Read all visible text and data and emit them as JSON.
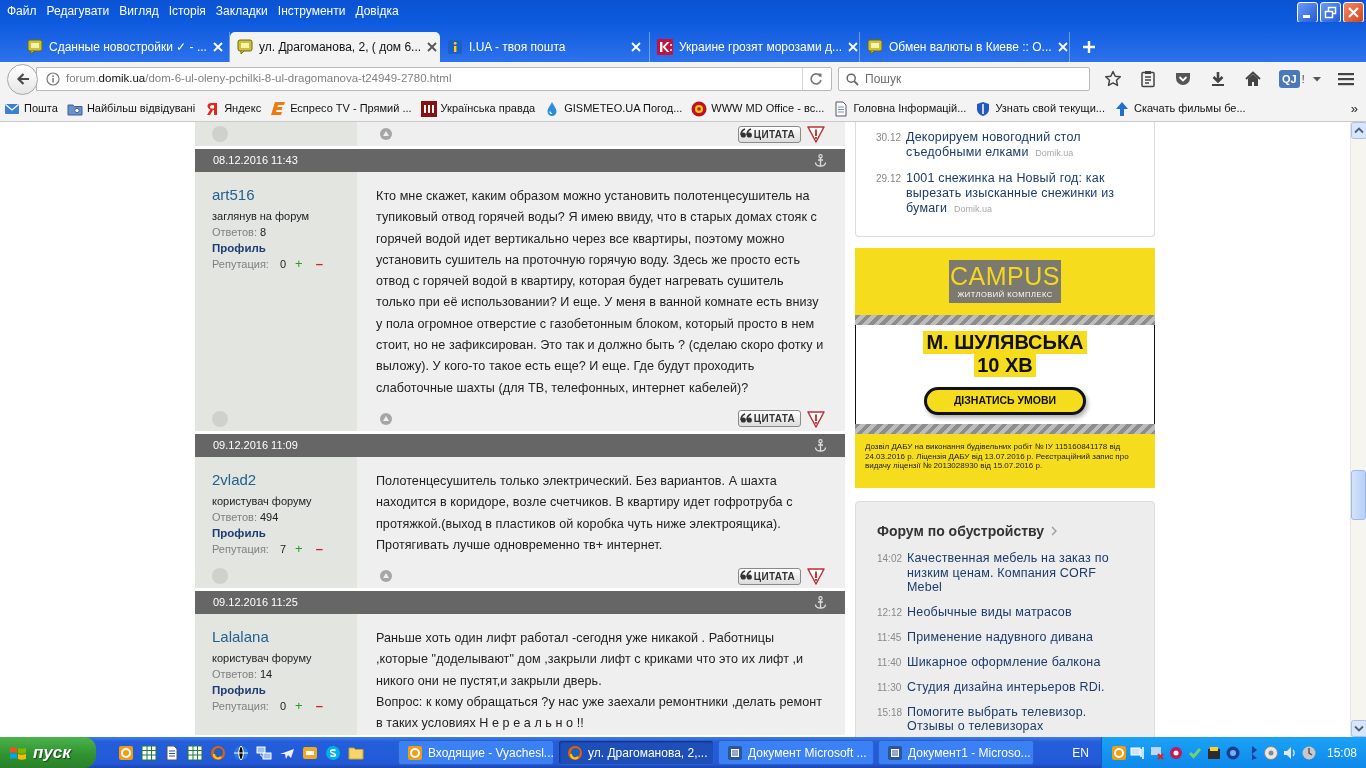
{
  "menu": [
    "Файл",
    "Редагувати",
    "Вигляд",
    "Історія",
    "Закладки",
    "Інструменти",
    "Довідка"
  ],
  "tabs": [
    {
      "title": "Сданные новостройки ✓ - ...",
      "selected": false
    },
    {
      "title": "ул. Драгоманова, 2, ( дом 6...",
      "selected": true
    },
    {
      "title": "I.UA - твоя пошта",
      "selected": false
    },
    {
      "title": "Украине грозят морозами д...",
      "selected": false
    },
    {
      "title": "Обмен валюты в Киеве :: О...",
      "selected": false
    }
  ],
  "address": {
    "url_prefix": "forum.",
    "url_domain": "domik.ua",
    "url_path": "/dom-6-ul-oleny-pchilki-8-ul-dragomanova-t24949-2780.html"
  },
  "search": {
    "placeholder": "Пошук"
  },
  "extension": {
    "label": "QJ",
    "badge": "!"
  },
  "bookmarks": [
    {
      "title": "Пошта"
    },
    {
      "title": "Найбільш відвідувані"
    },
    {
      "title": "Яндекс"
    },
    {
      "title": "Еспресо TV - Прямий ..."
    },
    {
      "title": "Українська правда"
    },
    {
      "title": "GISMETEO.UA Погод..."
    },
    {
      "title": "WWW MD Office - вс..."
    },
    {
      "title": "Головна Інформацій..."
    },
    {
      "title": "Узнать свой текущи..."
    },
    {
      "title": "Скачать фильмы бе..."
    }
  ],
  "bookmarks_more": "»",
  "prev_post_footer": {
    "quote_button": "ЦИТАТА"
  },
  "posts": [
    {
      "date": "08.12.2016 11:43",
      "author": "art516",
      "rank": "заглянув на форум",
      "replies_label": "Ответов:",
      "replies": "8",
      "profile": "Профиль",
      "reputation_label": "Репутация:",
      "reputation": "0",
      "rep_plus": "+",
      "rep_minus": "–",
      "message": [
        "Кто мне скажет, каким образом можно установить полотенцесушитель на тупиковый отвод горячей воды? Я имею ввиду, что в старых домах стояк с горячей водой идет вертикально через все квартиры, поэтому можно установить сушитель на проточную горячую воду. Здесь же просто есть отвод с горячей водой в квартиру, которая будет нагревать сушитель только при её использовании? И еще. У меня в ванной комнате есть внизу у пола огромное отверстие с газобетонным блоком, который просто в нем стоит, но не зафиксирован. Это так и должно быть ? (сделаю скоро фотку и выложу). У кого-то такое есть еще? И еще. Где будут проходить слаботочные шахты (для ТВ, телефонных, интернет кабелей)?"
      ],
      "quote_button": "ЦИТАТА"
    },
    {
      "date": "09.12.2016 11:09",
      "author": "2vlad2",
      "rank": "користувач форуму",
      "replies_label": "Ответов:",
      "replies": "494",
      "profile": "Профиль",
      "reputation_label": "Репутация:",
      "reputation": "7",
      "rep_plus": "+",
      "rep_minus": "–",
      "message": [
        "Полотенцесушитель только электрический. Без вариантов. А шахта находится в коридоре, возле счетчиков. В квартиру идет гофротруба с протяжкой.(выход в пластиков ой коробка чуть ниже электроящика). Протягивать лучше одновременно тв+ интернет."
      ],
      "quote_button": "ЦИТАТА"
    },
    {
      "date": "09.12.2016 11:25",
      "author": "Lalalana",
      "rank": "користувач форуму",
      "replies_label": "Ответов:",
      "replies": "14",
      "profile": "Профиль",
      "reputation_label": "Репутация:",
      "reputation": "0",
      "rep_plus": "+",
      "rep_minus": "–",
      "message": [
        "Раньше хоть один лифт работал -сегодня уже никакой . Работницы ,которые \"доделывают\" дом ,закрыли лифт с криками что это их лифт ,и никого они не пустят,и закрыли дверь.",
        "Вопрос: к кому обращаться ?у нас уже заехали ремонтники ,делать ремонт в таких условиях Н е р е а л ь н о !!"
      ]
    }
  ],
  "sidebar": {
    "news": [
      {
        "date": "30.12",
        "title": "Декорируем новогодний стол съедобными елками",
        "source": "Domik.ua"
      },
      {
        "date": "29.12",
        "title": "1001 снежинка на Новый год: как вырезать изысканные снежинки из бумаги",
        "source": "Domik.ua"
      }
    ],
    "ad": {
      "brand": "CAMPUS",
      "tagline": "ЖИТЛОВИЙ КОМПЛЕКС",
      "headline": "М. ШУЛЯВСЬКА",
      "subline": "10 ХВ",
      "button": "ДІЗНАТИСЬ УМОВИ",
      "fine_print": "Дозвіл ДАБУ на виконання будівельних робіт № ІУ 115160841178 від 24.03.2016 р. Ліцензія ДАБУ від 13.07.2016 р. Реєстраційний запис про видачу ліцензії № 2013028930 від 15.07.2016 р."
    },
    "forum": {
      "title": "Форум по обустройству",
      "items": [
        {
          "time": "14:02",
          "title": "Качественная мебель на заказ по низким ценам. Компания CORF Mebel"
        },
        {
          "time": "12:12",
          "title": "Необычные виды матрасов"
        },
        {
          "time": "11:45",
          "title": "Применение надувного дивана"
        },
        {
          "time": "11:40",
          "title": "Шикарное оформление балкона"
        },
        {
          "time": "11:30",
          "title": "Студия дизайна интерьеров RDi."
        },
        {
          "time": "15:18",
          "title": "Помогите выбрать телевизор. Отзывы о телевизорах"
        }
      ]
    }
  },
  "taskbar": {
    "start": "пуск",
    "tasks": [
      {
        "title": "Входящие - Vyachesl...",
        "selected": false
      },
      {
        "title": "ул. Драгоманова, 2,...",
        "selected": true
      },
      {
        "title": "Документ Microsoft ...",
        "selected": false
      },
      {
        "title": "Документ1 - Microso...",
        "selected": false
      }
    ],
    "language": "EN",
    "clock": "15:08"
  }
}
